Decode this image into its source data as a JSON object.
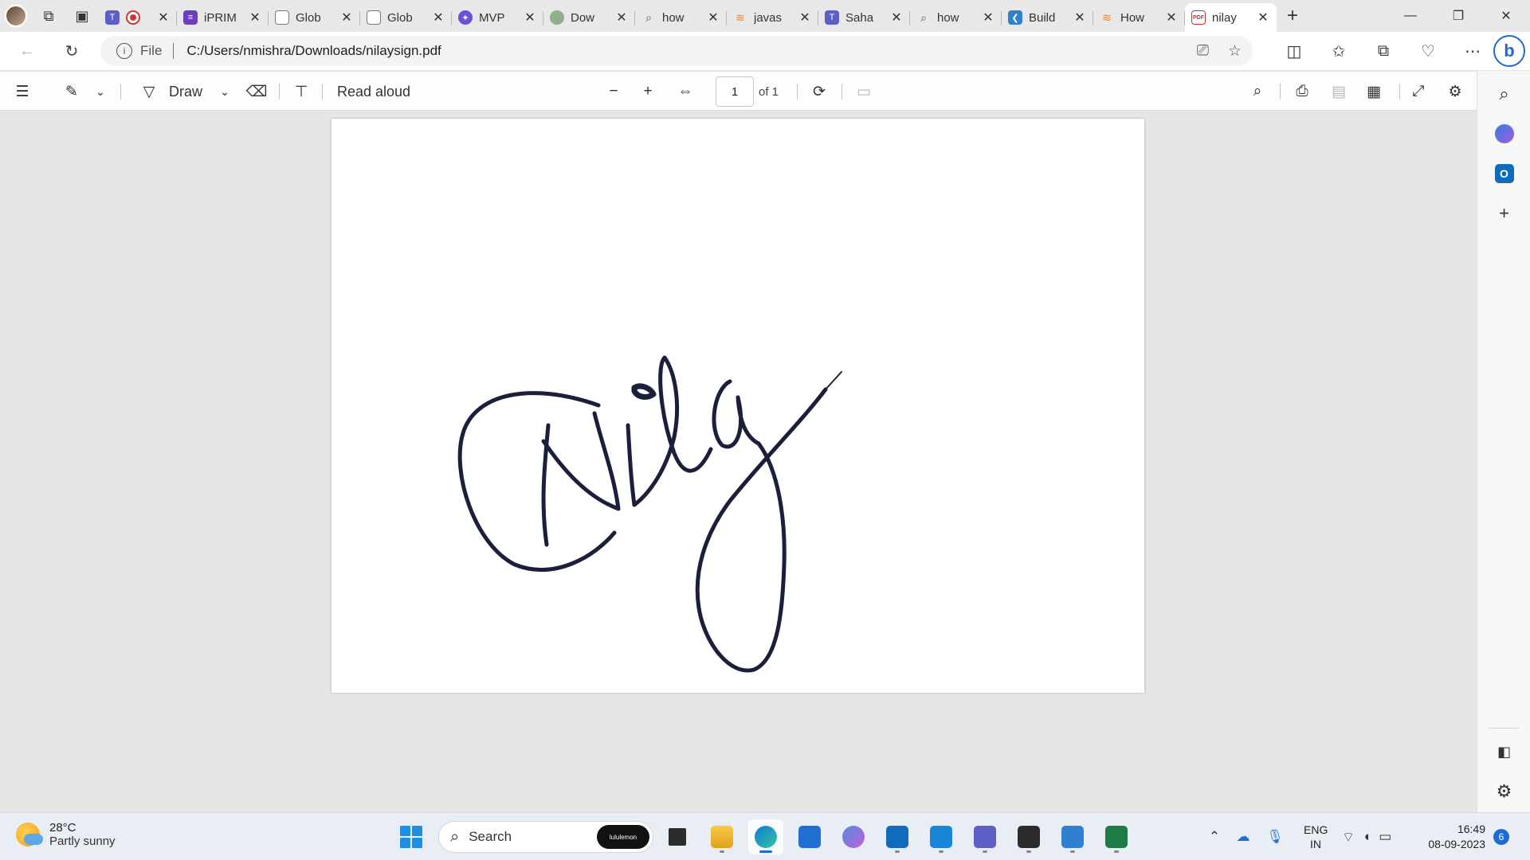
{
  "tabs": [
    {
      "label": "",
      "icon": "teams-icon",
      "color": "#5b5fc7",
      "extra": "record-icon"
    },
    {
      "label": "iPRIM",
      "icon": "forms-icon",
      "color": "#6d3fbf"
    },
    {
      "label": "Glob",
      "icon": "page-icon",
      "color": "#ffffff"
    },
    {
      "label": "Glob",
      "icon": "page-icon",
      "color": "#ffffff"
    },
    {
      "label": "MVP",
      "icon": "mvp-icon",
      "color": "#6b4fd8"
    },
    {
      "label": "Dow",
      "icon": "node-icon",
      "color": "#8fb08a"
    },
    {
      "label": "how",
      "icon": "search-icon",
      "color": "#ffffff"
    },
    {
      "label": "javas",
      "icon": "stackoverflow-icon",
      "color": "#ffffff"
    },
    {
      "label": "Saha",
      "icon": "teams-icon",
      "color": "#5b5fc7"
    },
    {
      "label": "how",
      "icon": "search-icon",
      "color": "#ffffff"
    },
    {
      "label": "Build",
      "icon": "vscode-icon",
      "color": "#2f80d1"
    },
    {
      "label": "How",
      "icon": "stackoverflow-icon",
      "color": "#ffffff"
    },
    {
      "label": "nilay",
      "icon": "pdf-icon",
      "color": "#d92b2b",
      "active": true
    }
  ],
  "address": {
    "scheme": "File",
    "url": "C:/Users/nmishra/Downloads/nilaysign.pdf"
  },
  "pdf_toolbar": {
    "draw_label": "Draw",
    "read_aloud_label": "Read aloud",
    "page_current": "1",
    "page_total_label": "of 1"
  },
  "taskbar": {
    "weather_temp": "28°C",
    "weather_desc": "Partly sunny",
    "search_placeholder": "Search",
    "search_promo": "lululemon",
    "lang_line1": "ENG",
    "lang_line2": "IN",
    "time": "16:49",
    "date": "08-09-2023",
    "notification_count": "6"
  },
  "colors": {
    "accent": "#1d6ad3",
    "ink": "#1b1f3b"
  }
}
